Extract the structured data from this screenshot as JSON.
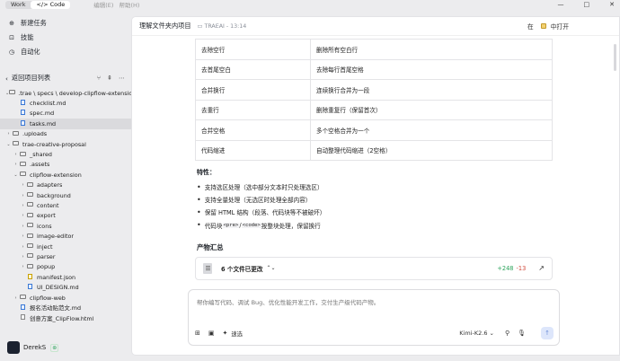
{
  "topbar": {
    "mode_work": "Work",
    "mode_code": "</> Code",
    "menus": [
      "编辑(E)",
      "帮助(H)"
    ],
    "win_minimize": "—",
    "win_maximize": "□",
    "win_close": "✕"
  },
  "sidebar": {
    "nav": [
      {
        "label": "新建任务",
        "icon": "new-task-icon",
        "glyph": "⊕"
      },
      {
        "label": "技能",
        "icon": "skills-icon",
        "glyph": "⊡"
      },
      {
        "label": "自动化",
        "icon": "automation-icon",
        "glyph": "◷"
      }
    ],
    "back_label": "返回项目列表",
    "tree": [
      {
        "label": ".trae \\ specs \\ develop-clipflow-extension",
        "indent": 0,
        "type": "folder",
        "open": true
      },
      {
        "label": "checklist.md",
        "indent": 1,
        "type": "file"
      },
      {
        "label": "spec.md",
        "indent": 1,
        "type": "file"
      },
      {
        "label": "tasks.md",
        "indent": 1,
        "type": "file",
        "selected": true
      },
      {
        "label": ".uploads",
        "indent": 0,
        "type": "folder",
        "open": false
      },
      {
        "label": "trae-creative-proposal",
        "indent": 0,
        "type": "folder",
        "open": true
      },
      {
        "label": "_shared",
        "indent": 1,
        "type": "folder",
        "open": false
      },
      {
        "label": ".assets",
        "indent": 1,
        "type": "folder",
        "open": false
      },
      {
        "label": "clipflow-extension",
        "indent": 1,
        "type": "folder",
        "open": true
      },
      {
        "label": "adapters",
        "indent": 2,
        "type": "folder",
        "open": false
      },
      {
        "label": "background",
        "indent": 2,
        "type": "folder",
        "open": false
      },
      {
        "label": "content",
        "indent": 2,
        "type": "folder",
        "open": false
      },
      {
        "label": "export",
        "indent": 2,
        "type": "folder",
        "open": false
      },
      {
        "label": "icons",
        "indent": 2,
        "type": "folder",
        "open": false
      },
      {
        "label": "image-editor",
        "indent": 2,
        "type": "folder",
        "open": false
      },
      {
        "label": "inject",
        "indent": 2,
        "type": "folder",
        "open": false
      },
      {
        "label": "parser",
        "indent": 2,
        "type": "folder",
        "open": false
      },
      {
        "label": "popup",
        "indent": 2,
        "type": "folder",
        "open": false
      },
      {
        "label": "manifest.json",
        "indent": 2,
        "type": "json"
      },
      {
        "label": "UI_DESIGN.md",
        "indent": 2,
        "type": "file"
      },
      {
        "label": "clipflow-web",
        "indent": 1,
        "type": "folder",
        "open": false
      },
      {
        "label": "报名活动贴范文.md",
        "indent": 1,
        "type": "file"
      },
      {
        "label": "创意方案_ClipFlow.html",
        "indent": 1,
        "type": "html"
      }
    ],
    "user": {
      "name": "DerekS",
      "badge": "⊛"
    }
  },
  "main": {
    "title": "理解文件夹内项目",
    "folder_icon": "folder-icon",
    "subtitle": "TRAEAI - 13:14",
    "open_in": "在",
    "open_btn": "中打开",
    "table": [
      [
        "去除空行",
        "删除所有空白行"
      ],
      [
        "去首尾空白",
        "去除每行首尾空格"
      ],
      [
        "合并换行",
        "连续换行合并为一段"
      ],
      [
        "去重行",
        "删除重复行（保留首次）"
      ],
      [
        "合并空格",
        "多个空格合并为一个"
      ],
      [
        "代码缩进",
        "自动整理代码缩进（2空格）"
      ]
    ],
    "features_title": "特性：",
    "features": [
      {
        "text": "支持选区处理（选中部分文本时只处理选区）"
      },
      {
        "text": "支持全量处理（无选区时处理全部内容）"
      },
      {
        "text": "保留 HTML 结构（段落、代码块等不被破坏）"
      },
      {
        "pre": "代码块 ",
        "code1": "<pre>",
        "sep": "/",
        "code2": "<code>",
        "post": " 按整块处理，保留换行"
      }
    ],
    "summary_title": "产物汇总",
    "summary_label": "6 个文件已更改",
    "additions": "+248",
    "deletions": "-13",
    "input_placeholder": "帮你编写代码、调试 Bug、优化性能开发工作，交付生产级代码产物。",
    "tool_send_mode": "速选",
    "model": "Kimi-K2.6 ⌄"
  }
}
